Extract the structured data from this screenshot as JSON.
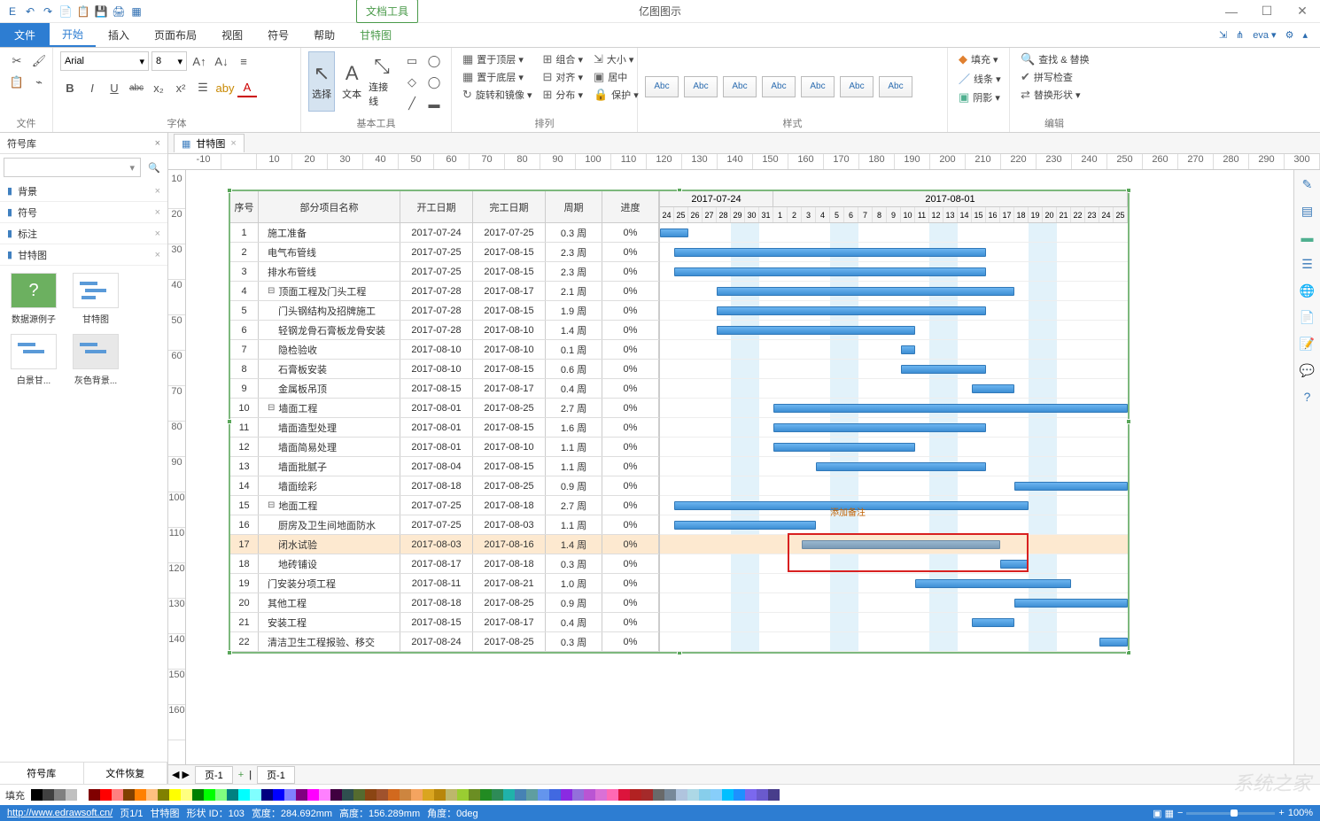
{
  "app": {
    "title": "亿图图示",
    "doc_tools": "文档工具"
  },
  "win": {
    "min": "—",
    "max": "☐",
    "close": "✕"
  },
  "qat": [
    "E",
    "↶",
    "↷",
    "📄",
    "📋",
    "💾",
    "🖨",
    "▦"
  ],
  "tabs": {
    "file": "文件",
    "items": [
      "开始",
      "插入",
      "页面布局",
      "视图",
      "符号",
      "帮助",
      "甘特图"
    ],
    "active": 0
  },
  "ribbon_right": {
    "share1": "⇲",
    "share2": "⋔",
    "user": "eva ▾",
    "gear": "⚙",
    "collapse": "▴"
  },
  "ribbon": {
    "clipboard": {
      "label": "文件",
      "cut": "✂",
      "brush": "🖌",
      "copy": "📋",
      "pick": "⌁"
    },
    "font": {
      "label": "字体",
      "name": "Arial",
      "size": "8",
      "btns": [
        "B",
        "I",
        "U",
        "abc",
        "x₂",
        "x²"
      ],
      "incdec": [
        "A↑",
        "A↓"
      ],
      "align": "≡",
      "list": "☰",
      "color1": "aby",
      "color2": "A"
    },
    "basic": {
      "label": "基本工具",
      "select": "选择",
      "text": "文本",
      "conn": "连接线"
    },
    "shapes": [
      "▭",
      "◯",
      "◇",
      "◯",
      "╱",
      "▬",
      "●",
      "▭"
    ],
    "arrange": {
      "label": "排列",
      "items": [
        "置于顶层 ▾",
        "置于底层 ▾",
        "旋转和镜像 ▾",
        "组合 ▾",
        "对齐 ▾",
        "分布 ▾",
        "大小 ▾",
        "居中",
        "保护 ▾"
      ]
    },
    "styles": {
      "label": "样式",
      "swatch_text": "Abc"
    },
    "fill": {
      "label": "",
      "fill": "填充 ▾",
      "line": "线条 ▾",
      "shadow": "阴影 ▾"
    },
    "edit": {
      "label": "编辑",
      "find": "查找 & 替换",
      "spell": "拼写检查",
      "replace": "替换形状 ▾"
    }
  },
  "symlib": {
    "title": "符号库",
    "cats": [
      "背景",
      "符号",
      "标注",
      "甘特图"
    ],
    "thumbs": [
      "数据源例子",
      "甘特图",
      "白景甘...",
      "灰色背景..."
    ]
  },
  "bottom_tabs": [
    "符号库",
    "文件恢复"
  ],
  "doctab": {
    "name": "甘特图",
    "close": "×"
  },
  "h_ruler": [
    "-10",
    "",
    "10",
    "20",
    "30",
    "40",
    "50",
    "60",
    "70",
    "80",
    "90",
    "100",
    "110",
    "120",
    "130",
    "140",
    "150",
    "160",
    "170",
    "180",
    "190",
    "200",
    "210",
    "220",
    "230",
    "240",
    "250",
    "260",
    "270",
    "280",
    "290",
    "300"
  ],
  "v_ruler": [
    "10",
    "20",
    "30",
    "40",
    "50",
    "60",
    "70",
    "80",
    "90",
    "100",
    "110",
    "120",
    "130",
    "140",
    "150",
    "160"
  ],
  "gantt": {
    "headers": {
      "seq": "序号",
      "name": "部分项目名称",
      "start": "开工日期",
      "end": "完工日期",
      "dur": "周期",
      "prog": "进度"
    },
    "months": [
      "2017-07-24",
      "2017-08-01"
    ],
    "days": [
      "24",
      "25",
      "26",
      "27",
      "28",
      "29",
      "30",
      "31",
      "1",
      "2",
      "3",
      "4",
      "5",
      "6",
      "7",
      "8",
      "9",
      "10",
      "11",
      "12",
      "13",
      "14",
      "15",
      "16",
      "17",
      "18",
      "19",
      "20",
      "21",
      "22",
      "23",
      "24",
      "25"
    ],
    "annotation": "添加备注",
    "rows": [
      {
        "n": "1",
        "name": "施工准备",
        "s": "2017-07-24",
        "e": "2017-07-25",
        "d": "0.3 周",
        "p": "0%",
        "i": 0,
        "bs": 0,
        "bw": 2
      },
      {
        "n": "2",
        "name": "电气布管线",
        "s": "2017-07-25",
        "e": "2017-08-15",
        "d": "2.3 周",
        "p": "0%",
        "i": 0,
        "bs": 1,
        "bw": 22
      },
      {
        "n": "3",
        "name": "排水布管线",
        "s": "2017-07-25",
        "e": "2017-08-15",
        "d": "2.3 周",
        "p": "0%",
        "i": 0,
        "bs": 1,
        "bw": 22
      },
      {
        "n": "4",
        "name": "顶面工程及门头工程",
        "s": "2017-07-28",
        "e": "2017-08-17",
        "d": "2.1 周",
        "p": "0%",
        "i": 0,
        "bs": 4,
        "bw": 21,
        "exp": "⊟"
      },
      {
        "n": "5",
        "name": "门头钢结构及招牌施工",
        "s": "2017-07-28",
        "e": "2017-08-15",
        "d": "1.9 周",
        "p": "0%",
        "i": 1,
        "bs": 4,
        "bw": 19
      },
      {
        "n": "6",
        "name": "轻钢龙骨石膏板龙骨安装",
        "s": "2017-07-28",
        "e": "2017-08-10",
        "d": "1.4 周",
        "p": "0%",
        "i": 1,
        "bs": 4,
        "bw": 14
      },
      {
        "n": "7",
        "name": "隐检验收",
        "s": "2017-08-10",
        "e": "2017-08-10",
        "d": "0.1 周",
        "p": "0%",
        "i": 1,
        "bs": 17,
        "bw": 1
      },
      {
        "n": "8",
        "name": "石膏板安装",
        "s": "2017-08-10",
        "e": "2017-08-15",
        "d": "0.6 周",
        "p": "0%",
        "i": 1,
        "bs": 17,
        "bw": 6
      },
      {
        "n": "9",
        "name": "金属板吊顶",
        "s": "2017-08-15",
        "e": "2017-08-17",
        "d": "0.4 周",
        "p": "0%",
        "i": 1,
        "bs": 22,
        "bw": 3
      },
      {
        "n": "10",
        "name": "墙面工程",
        "s": "2017-08-01",
        "e": "2017-08-25",
        "d": "2.7 周",
        "p": "0%",
        "i": 0,
        "bs": 8,
        "bw": 25,
        "exp": "⊟"
      },
      {
        "n": "11",
        "name": "墙面造型处理",
        "s": "2017-08-01",
        "e": "2017-08-15",
        "d": "1.6 周",
        "p": "0%",
        "i": 1,
        "bs": 8,
        "bw": 15
      },
      {
        "n": "12",
        "name": "墙面简易处理",
        "s": "2017-08-01",
        "e": "2017-08-10",
        "d": "1.1 周",
        "p": "0%",
        "i": 1,
        "bs": 8,
        "bw": 10
      },
      {
        "n": "13",
        "name": "墙面批腻子",
        "s": "2017-08-04",
        "e": "2017-08-15",
        "d": "1.1 周",
        "p": "0%",
        "i": 1,
        "bs": 11,
        "bw": 12
      },
      {
        "n": "14",
        "name": "墙面绘彩",
        "s": "2017-08-18",
        "e": "2017-08-25",
        "d": "0.9 周",
        "p": "0%",
        "i": 1,
        "bs": 25,
        "bw": 8
      },
      {
        "n": "15",
        "name": "地面工程",
        "s": "2017-07-25",
        "e": "2017-08-18",
        "d": "2.7 周",
        "p": "0%",
        "i": 0,
        "bs": 1,
        "bw": 25,
        "exp": "⊟"
      },
      {
        "n": "16",
        "name": "厨房及卫生间地面防水",
        "s": "2017-07-25",
        "e": "2017-08-03",
        "d": "1.1 周",
        "p": "0%",
        "i": 1,
        "bs": 1,
        "bw": 10
      },
      {
        "n": "17",
        "name": "闭水试验",
        "s": "2017-08-03",
        "e": "2017-08-16",
        "d": "1.4 周",
        "p": "0%",
        "i": 1,
        "bs": 10,
        "bw": 14,
        "sel": true
      },
      {
        "n": "18",
        "name": "地砖铺设",
        "s": "2017-08-17",
        "e": "2017-08-18",
        "d": "0.3 周",
        "p": "0%",
        "i": 1,
        "bs": 24,
        "bw": 2
      },
      {
        "n": "19",
        "name": "门安装分项工程",
        "s": "2017-08-11",
        "e": "2017-08-21",
        "d": "1.0 周",
        "p": "0%",
        "i": 0,
        "bs": 18,
        "bw": 11
      },
      {
        "n": "20",
        "name": "其他工程",
        "s": "2017-08-18",
        "e": "2017-08-25",
        "d": "0.9 周",
        "p": "0%",
        "i": 0,
        "bs": 25,
        "bw": 8
      },
      {
        "n": "21",
        "name": "安装工程",
        "s": "2017-08-15",
        "e": "2017-08-17",
        "d": "0.4 周",
        "p": "0%",
        "i": 0,
        "bs": 22,
        "bw": 3
      },
      {
        "n": "22",
        "name": "清洁卫生工程报验、移交",
        "s": "2017-08-24",
        "e": "2017-08-25",
        "d": "0.3 周",
        "p": "0%",
        "i": 0,
        "bs": 31,
        "bw": 2
      }
    ]
  },
  "pagetab": {
    "nav": "◀ ▶",
    "page": "页-1",
    "add": "+"
  },
  "colorbar_label": "填充",
  "status": {
    "url": "http://www.edrawsoft.cn/",
    "page": "页1/1",
    "shape": "甘特图",
    "id": "形状 ID：103",
    "w": "宽度：284.692mm",
    "h": "高度：156.289mm",
    "ang": "角度：0deg",
    "zoom": "100%"
  },
  "colors": [
    "#000000",
    "#404040",
    "#808080",
    "#c0c0c0",
    "#ffffff",
    "#800000",
    "#ff0000",
    "#ff8080",
    "#804000",
    "#ff8000",
    "#ffc080",
    "#808000",
    "#ffff00",
    "#ffff80",
    "#008000",
    "#00ff00",
    "#80ff80",
    "#008080",
    "#00ffff",
    "#80ffff",
    "#000080",
    "#0000ff",
    "#8080ff",
    "#800080",
    "#ff00ff",
    "#ff80ff",
    "#400040",
    "#2f4f4f",
    "#556b2f",
    "#8b4513",
    "#a0522d",
    "#d2691e",
    "#cd853f",
    "#f4a460",
    "#daa520",
    "#b8860b",
    "#bdb76b",
    "#9acd32",
    "#6b8e23",
    "#228b22",
    "#2e8b57",
    "#20b2aa",
    "#4682b4",
    "#5f9ea0",
    "#6495ed",
    "#4169e1",
    "#8a2be2",
    "#9370db",
    "#ba55d3",
    "#da70d6",
    "#ff69b4",
    "#dc143c",
    "#b22222",
    "#a52a2a",
    "#696969",
    "#778899",
    "#b0c4de",
    "#add8e6",
    "#87ceeb",
    "#87cefa",
    "#00bfff",
    "#1e90ff",
    "#7b68ee",
    "#6a5acd",
    "#483d8b"
  ],
  "watermark": "系统之家"
}
